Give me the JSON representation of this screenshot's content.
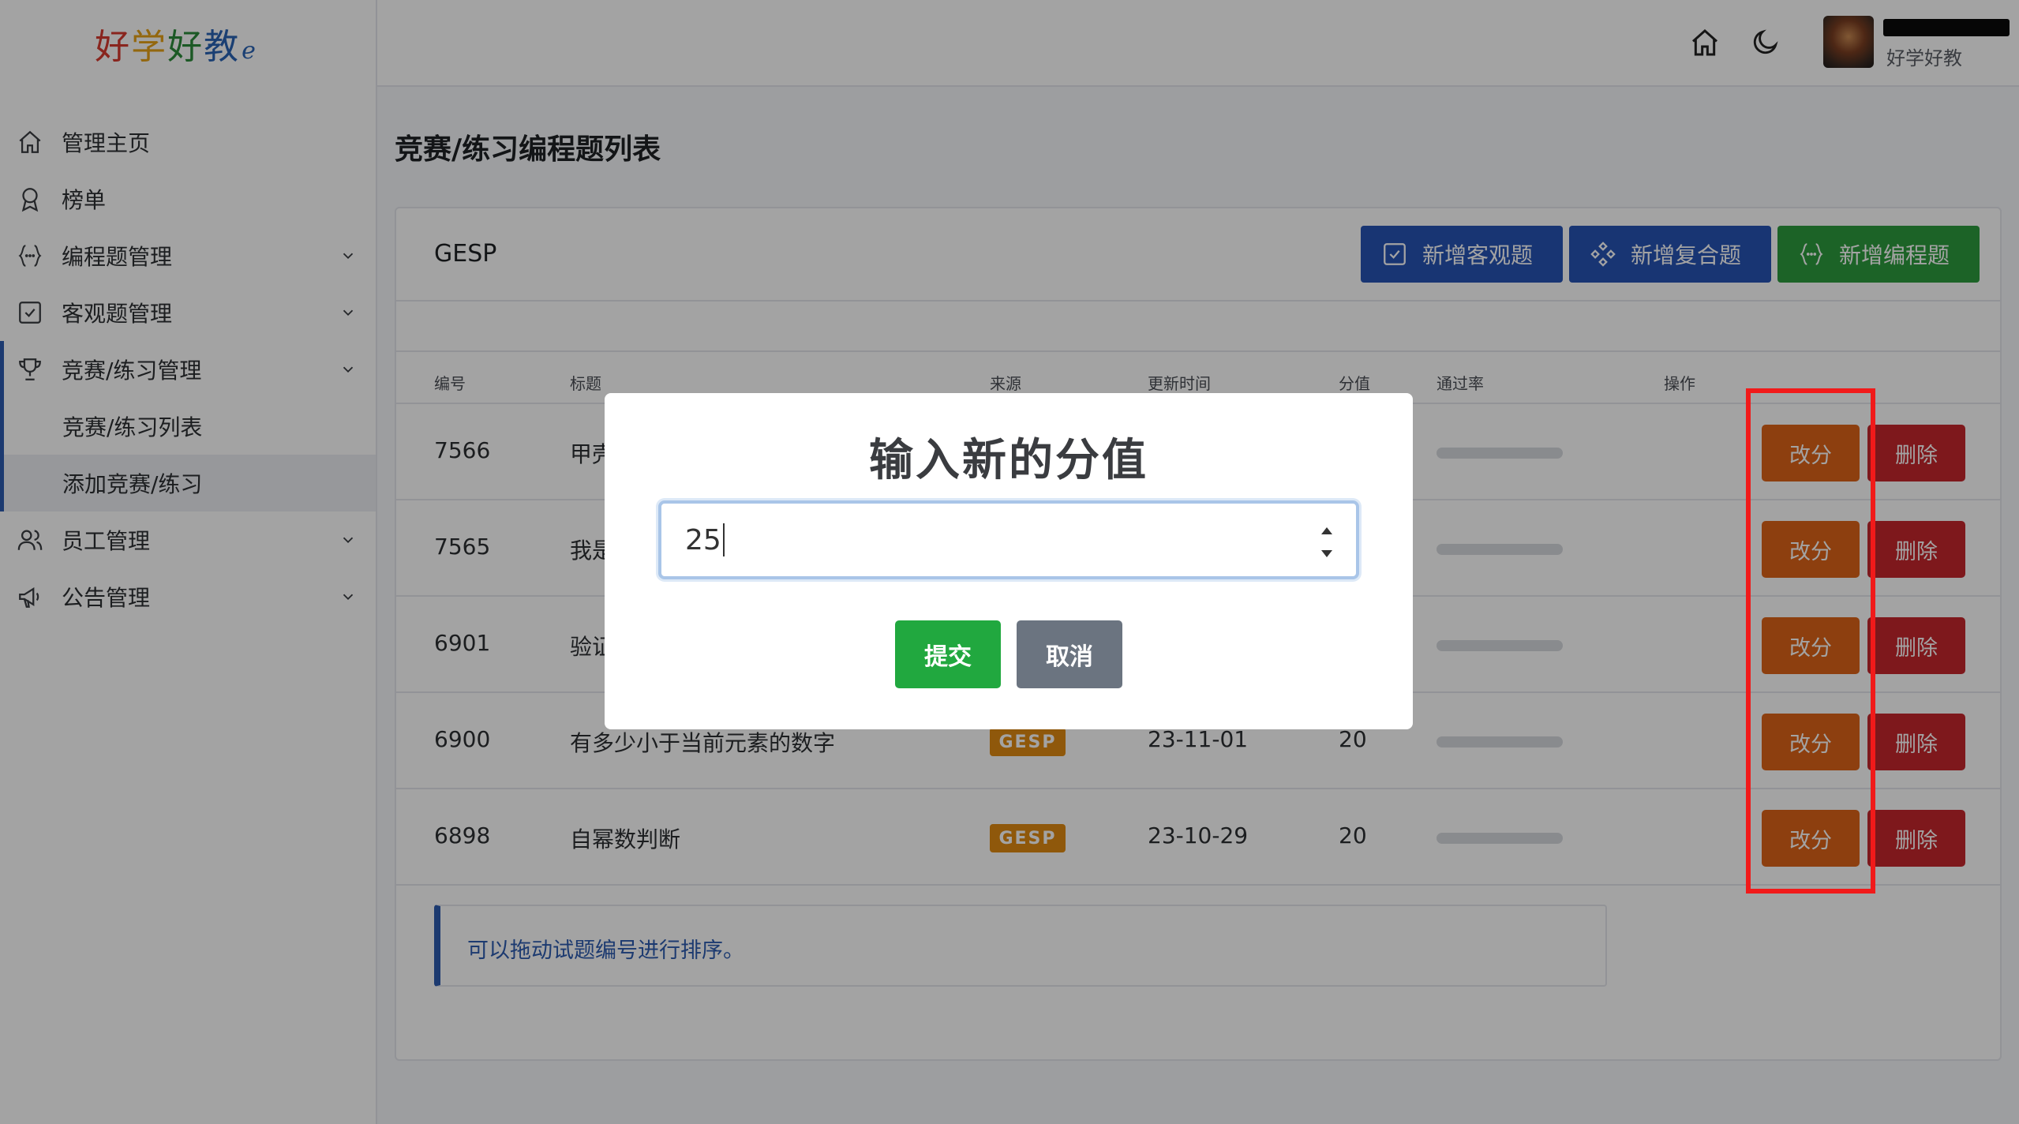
{
  "brand": {
    "logo_chars": [
      "好",
      "学",
      "好",
      "教"
    ],
    "logo_tail": "ℯ"
  },
  "sidebar": {
    "items": [
      {
        "label": "管理主页",
        "icon": "home-icon",
        "has_chevron": false
      },
      {
        "label": "榜单",
        "icon": "award-icon",
        "has_chevron": false
      },
      {
        "label": "编程题管理",
        "icon": "braces-icon",
        "has_chevron": true
      },
      {
        "label": "客观题管理",
        "icon": "checkbox-icon",
        "has_chevron": true
      },
      {
        "label": "竞赛/练习管理",
        "icon": "trophy-icon",
        "has_chevron": true,
        "expanded": true
      }
    ],
    "sub_items": [
      {
        "label": "竞赛/练习列表",
        "active": false
      },
      {
        "label": "添加竞赛/练习",
        "active": true
      }
    ],
    "items_after": [
      {
        "label": "员工管理",
        "icon": "users-icon",
        "has_chevron": true
      },
      {
        "label": "公告管理",
        "icon": "megaphone-icon",
        "has_chevron": true
      }
    ]
  },
  "header": {
    "home_icon": "home-icon",
    "theme_icon": "moon-icon",
    "user_name": "好学好教"
  },
  "page": {
    "title": "竞赛/练习编程题列表",
    "card_title": "GESP",
    "buttons": {
      "add_objective": "新增客观题",
      "add_composite": "新增复合题",
      "add_programming": "新增编程题"
    },
    "table": {
      "headers": [
        "编号",
        "标题",
        "来源",
        "更新时间",
        "分值",
        "通过率",
        "操作"
      ],
      "rows": [
        {
          "id": "7566",
          "title": "甲壳",
          "source": "",
          "updated": "",
          "score": ""
        },
        {
          "id": "7565",
          "title": "我是",
          "source": "",
          "updated": "",
          "score": ""
        },
        {
          "id": "6901",
          "title": "验证",
          "source": "",
          "updated": "",
          "score": ""
        },
        {
          "id": "6900",
          "title": "有多少小于当前元素的数字",
          "source": "GESP",
          "updated": "23-11-01",
          "score": "20"
        },
        {
          "id": "6898",
          "title": "自幂数判断",
          "source": "GESP",
          "updated": "23-10-29",
          "score": "20"
        }
      ],
      "edit_label": "改分",
      "delete_label": "删除"
    },
    "note": "可以拖动试题编号进行排序。"
  },
  "modal": {
    "title": "输入新的分值",
    "input_value": "25",
    "submit_label": "提交",
    "cancel_label": "取消"
  },
  "colors": {
    "primary_blue": "#2653b5",
    "success_green": "#2c9c3d",
    "warning_orange": "#dd6318",
    "danger_red": "#c6262c",
    "badge_orange": "#e08a12",
    "highlight_red": "#f11a1a"
  }
}
